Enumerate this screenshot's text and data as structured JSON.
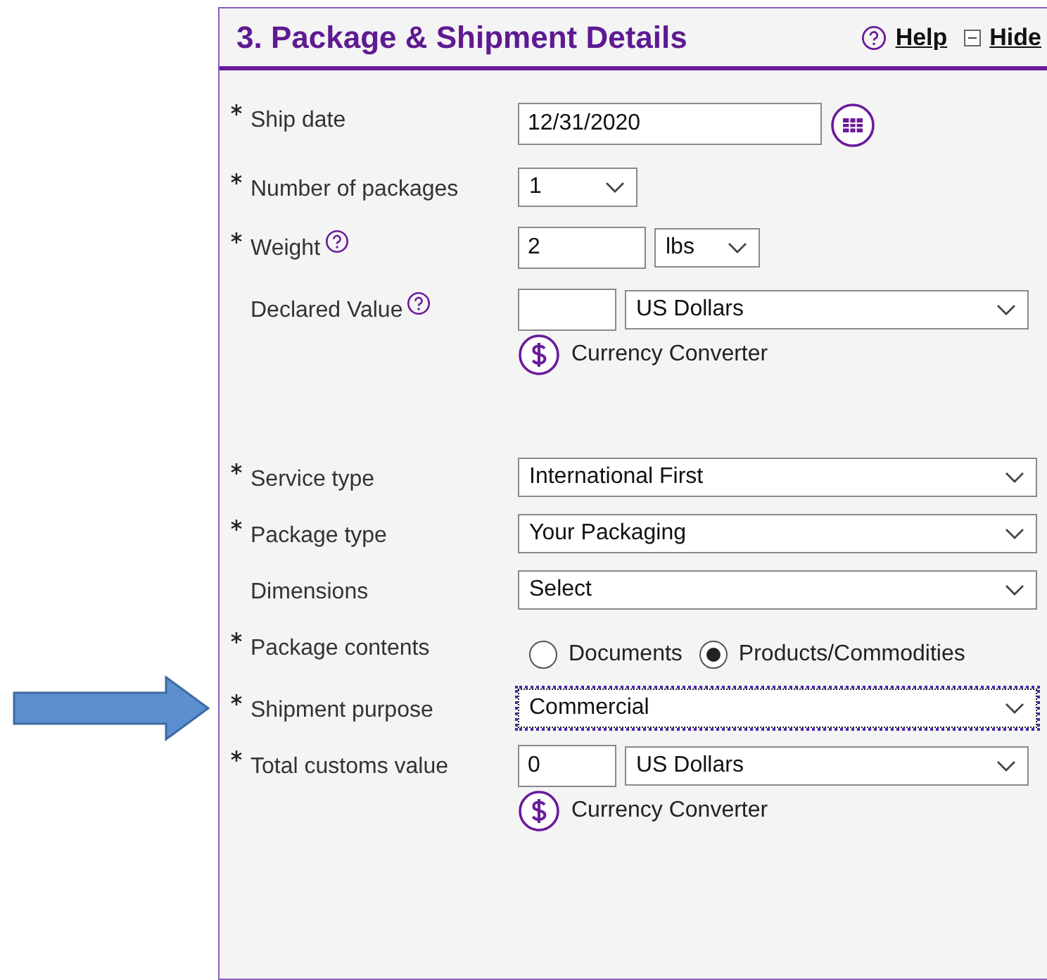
{
  "panel": {
    "title": "3. Package & Shipment Details",
    "links": [
      {
        "label": "Help",
        "kind": "help"
      },
      {
        "label": "Hide",
        "kind": "collapse"
      }
    ]
  },
  "sections": [
    {
      "fields": [
        {
          "label": "Ship date",
          "required": true,
          "kind": "date",
          "value": "12/31/2020"
        },
        {
          "label": "Number of packages",
          "required": true,
          "kind": "short_select",
          "value": "1"
        },
        {
          "label": "Weight",
          "required": true,
          "help": true,
          "kind": "amount",
          "value": "2",
          "unit": "lbs"
        },
        {
          "label": "Declared Value",
          "required": false,
          "help": true,
          "kind": "money",
          "currency": "US Dollars",
          "converter": "Currency Converter"
        }
      ]
    },
    {
      "fields": [
        {
          "label": "Service type",
          "required": true,
          "kind": "select",
          "value": "International First",
          "focused": false
        },
        {
          "label": "Package type",
          "required": true,
          "kind": "select",
          "value": "Your Packaging",
          "focused": false
        },
        {
          "label": "Dimensions",
          "required": false,
          "kind": "select",
          "value": "Select",
          "focused": false
        },
        {
          "label": "Package contents",
          "required": true,
          "kind": "radio",
          "options": [
            {
              "label": "Documents",
              "selected": false
            },
            {
              "label": "Products/Commodities",
              "selected": true
            }
          ]
        },
        {
          "label": "Shipment purpose",
          "required": true,
          "kind": "select",
          "value": "Commercial",
          "focused": true
        },
        {
          "label": "Total customs value",
          "required": true,
          "kind": "money",
          "value": "0",
          "currency": "US Dollars",
          "converter": "Currency Converter"
        }
      ]
    }
  ]
}
